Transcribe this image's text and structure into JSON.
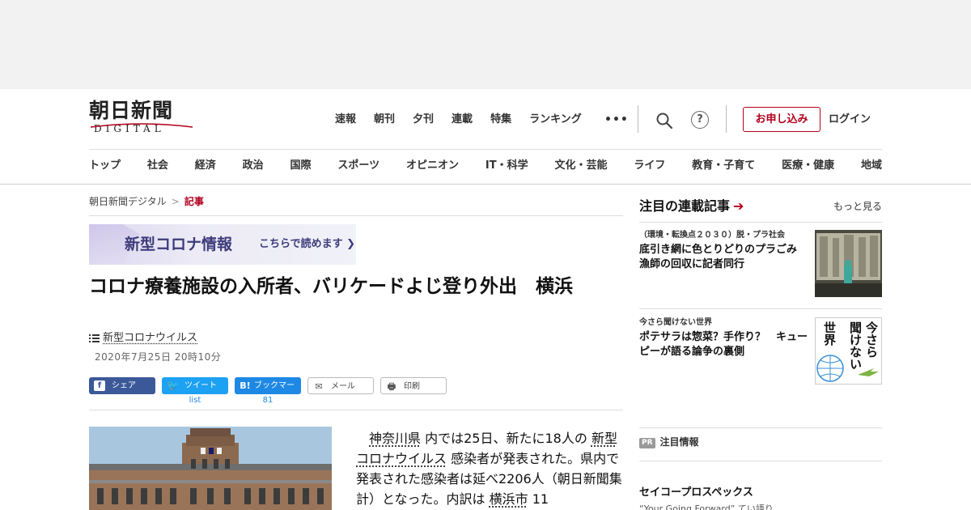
{
  "logo": {
    "main": "朝日新聞",
    "sub": "DIGITAL"
  },
  "top_nav": [
    "速報",
    "朝刊",
    "夕刊",
    "連載",
    "特集",
    "ランキング"
  ],
  "more_label": "•••",
  "help_label": "?",
  "signup_label": "お申し込み",
  "login_label": "ログイン",
  "categories": [
    "トップ",
    "社会",
    "経済",
    "政治",
    "国際",
    "スポーツ",
    "オピニオン",
    "IT・科学",
    "文化・芸能",
    "ライフ",
    "教育・子育て",
    "医療・健康",
    "地域"
  ],
  "breadcrumb": {
    "home": "朝日新聞デジタル",
    "sep": ">",
    "current": "記事"
  },
  "corona_banner": {
    "title": "新型コロナ情報",
    "link": "こちらで読めます ❯"
  },
  "article": {
    "headline": "コロナ療養施設の入所者、バリケードよじ登り外出　横浜",
    "topic": "新型コロナウイルス",
    "date": "2020年7月25日 20時10分",
    "body": {
      "indent": "　",
      "link1": "神奈川県",
      "t1": " 内では25日、新たに18人の ",
      "link2": "新型コロナウイルス",
      "t2": " 感染者が発表された。県内で発表された感染者は延べ2206人（朝日新聞集計）となった。内訳は ",
      "link3": "横浜市",
      "t3": " 11"
    }
  },
  "share": {
    "facebook": {
      "icon": "f",
      "label": "シェア"
    },
    "twitter": {
      "icon": "🐦",
      "label": "ツイート",
      "count": "list"
    },
    "hatena": {
      "icon": "B!",
      "label": "ブックマーク",
      "count": "81"
    },
    "mail": {
      "icon": "✉",
      "label": "メール"
    },
    "print": {
      "icon": "🖶",
      "label": "印刷"
    }
  },
  "sidebar": {
    "title": "注目の連載記事",
    "arrow": "➔",
    "more": "もっと見る",
    "items": [
      {
        "kicker": "（環境・転換点２０３０）脱・プラ社会",
        "headline": "底引き網に色とりどりのプラごみ　漁師の回収に記者同行"
      },
      {
        "kicker": "今さら聞けない世界",
        "headline": "ポテサラは惣菜？手作り？　キューピーが語る論争の裏側",
        "thumb_text_a": "今さら",
        "thumb_text_b": "聞けない",
        "thumb_text_c": "世界"
      }
    ],
    "pr": {
      "badge": "PR",
      "label": "注目情報"
    },
    "advertiser": "セイコープロスペックス",
    "advertiser_sub": "“Your Going Forward” てい語り"
  },
  "colors": {
    "brand_red": "#b2001d",
    "facebook": "#3b5998",
    "twitter": "#1da1f2",
    "hatena": "#1e88e5",
    "corona_text": "#3d3b7a"
  }
}
